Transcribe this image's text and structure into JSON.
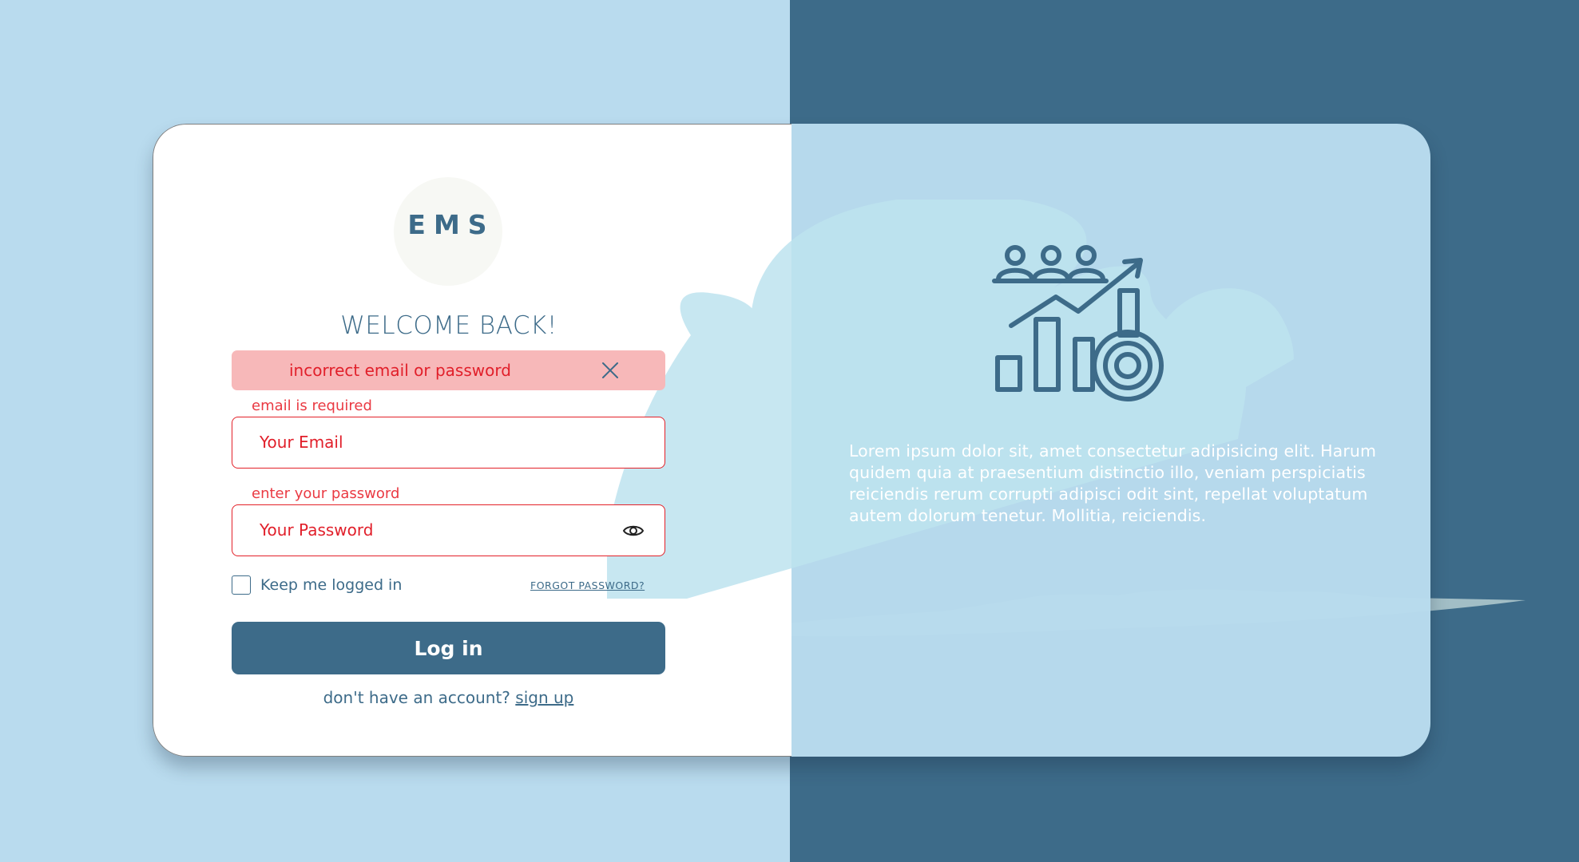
{
  "brand": {
    "logo_text": "EMS"
  },
  "login_form": {
    "heading": "WELCOME BACK!",
    "error_banner": {
      "message": "incorrect email or password",
      "close_icon": "close-icon"
    },
    "email": {
      "hint": "email is required",
      "placeholder": "Your Email",
      "value": ""
    },
    "password": {
      "hint": "enter your password",
      "placeholder": "Your Password",
      "value": "",
      "toggle_icon": "eye-icon"
    },
    "remember_me": {
      "label": "Keep me logged in",
      "checked": false
    },
    "forgot_password": "FORGOT PASSWORD?",
    "submit_label": "Log in",
    "signup_prompt": "don't have an account?",
    "signup_link": "sign up"
  },
  "side_panel": {
    "illustration_icon": "team-growth-chart-gear-icon",
    "description": "Lorem ipsum dolor sit, amet consectetur adipisicing elit. Harum quidem quia at praesentium distinctio illo, veniam perspiciatis reiciendis rerum corrupti adipisci odit sint, repellat voluptatum autem dolorum tenetur. Mollitia, reiciendis."
  },
  "colors": {
    "primary": "#3d6b89",
    "page_light": "#b9dbee",
    "error_text": "#e11f2a",
    "error_background": "#f7b8b9",
    "card": "#ffffff"
  }
}
